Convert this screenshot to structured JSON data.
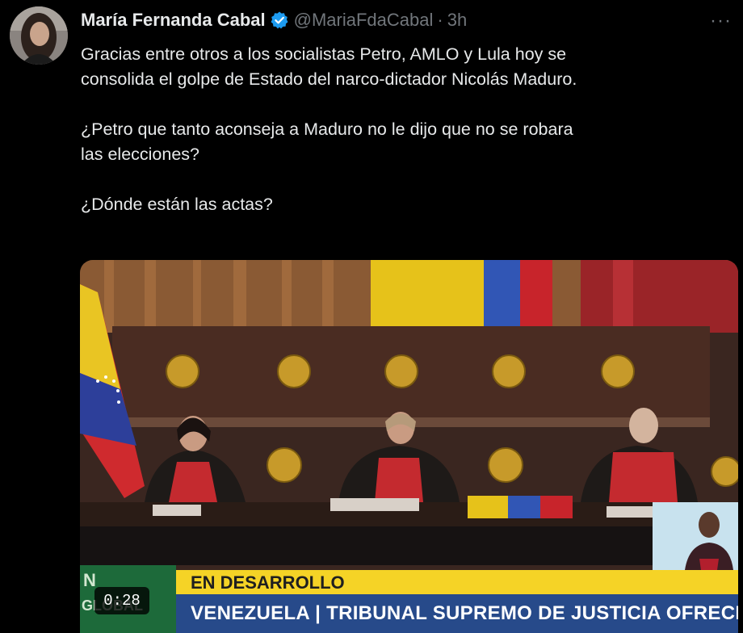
{
  "tweet": {
    "author_name": "María Fernanda Cabal",
    "handle": "@MariaFdaCabal",
    "separator": "·",
    "time": "3h",
    "more": "···",
    "paragraphs": [
      "Gracias entre otros a los socialistas Petro, AMLO y Lula hoy se\nconsolida el golpe de Estado del narco-dictador Nicolás Maduro.",
      "¿Petro que tanto aconseja a Maduro no le dijo que no se robara\nlas elecciones?",
      "¿Dónde están las actas?"
    ]
  },
  "video": {
    "duration": "0:28",
    "ticker_top": "EN DESARROLLO",
    "ticker_bottom": "VENEZUELA | TRIBUNAL SUPREMO DE JUSTICIA OFRECE DECLARACIÓN",
    "brand_top": "N",
    "brand_bottom": "GLOBAL"
  },
  "colors": {
    "background": "#000000",
    "verified_badge": "#1d9bf0",
    "secondary_text": "#71767b",
    "ticker_yellow": "#f5d326",
    "ticker_blue": "#274a8a"
  }
}
